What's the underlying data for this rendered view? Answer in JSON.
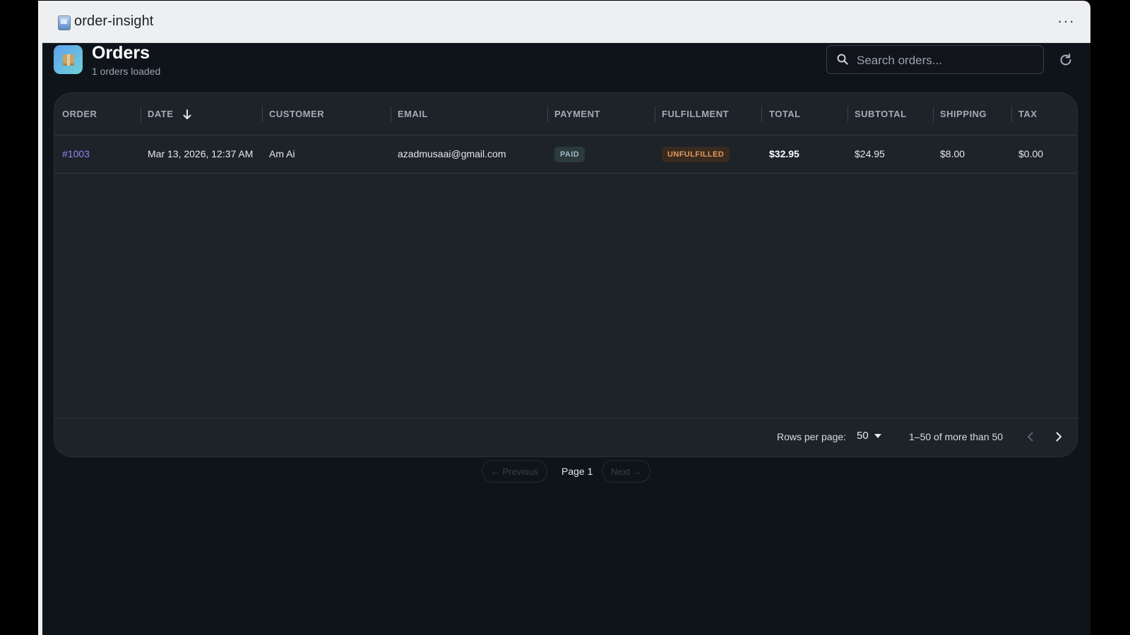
{
  "window": {
    "title": "order-insight",
    "menu_icon": "more-horizontal-icon"
  },
  "header": {
    "title": "Orders",
    "subtitle": "1 orders loaded",
    "logo_icon": "package-icon",
    "search": {
      "placeholder": "Search orders...",
      "value": ""
    },
    "refresh_icon": "refresh-icon"
  },
  "table": {
    "columns": [
      "ORDER",
      "DATE",
      "CUSTOMER",
      "EMAIL",
      "PAYMENT",
      "FULFILLMENT",
      "TOTAL",
      "SUBTOTAL",
      "SHIPPING",
      "TAX"
    ],
    "sort": {
      "column": "DATE",
      "direction": "desc",
      "icon": "arrow-down-icon"
    },
    "rows": [
      {
        "order": "#1003",
        "date": "Mar 13, 2026, 12:37 AM",
        "customer": "Am Ai",
        "email": "azadmusaai@gmail.com",
        "payment": "PAID",
        "fulfillment": "UNFULFILLED",
        "total": "$32.95",
        "subtotal": "$24.95",
        "shipping": "$8.00",
        "tax": "$0.00"
      }
    ]
  },
  "footer": {
    "rows_per_page_label": "Rows per page:",
    "rows_per_page_value": "50",
    "range_text": "1–50 of more than 50"
  },
  "pager": {
    "previous_label": "← Previous",
    "page_label": "Page 1",
    "next_label": "Next →"
  },
  "colors": {
    "background": "#0f131a",
    "card": "#1e2229",
    "link": "#8d8cf5",
    "paid_badge": "#2a3a3d",
    "unfulfilled_badge": "#3a2a1e",
    "unfulfilled_text": "#e29b62"
  }
}
